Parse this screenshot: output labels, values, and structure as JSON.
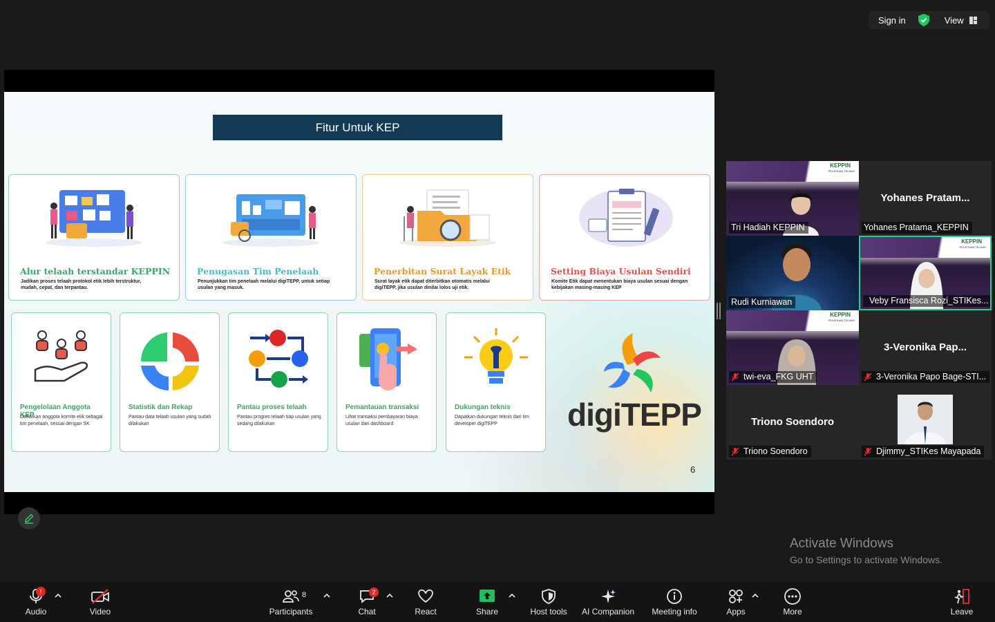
{
  "topbar": {
    "sign_in": "Sign in",
    "view": "View"
  },
  "slide": {
    "title": "Fitur Untuk KEP",
    "page_number": "6",
    "logo_text": "digiTEPP",
    "top_cards": [
      {
        "title": "Alur telaah terstandar KEPPIN",
        "desc": "Jadikan proses telaah protokol etik lebih terstruktur, mudah, cepat, dan terpantau.",
        "color": "#3fa36b",
        "border": "#8ed1a8"
      },
      {
        "title": "Penugasan Tim Penelaah",
        "desc": "Penunjukkan tim penelaah melalui digiTEPP, untuk setiap usulan yang masuk.",
        "color": "#4fb8c8",
        "border": "#8fd0e0"
      },
      {
        "title": "Penerbitan Surat Layak Etik",
        "desc": "Surat layak etik dapat diterbitkan otomatis melalui digiTEPP, jika usulan dinilai lolos uji etik.",
        "color": "#e39a2a",
        "border": "#f2c98a"
      },
      {
        "title": "Setting Biaya Usulan Sendiri",
        "desc": "Komite Etik dapat menentukan biaya usulan sesuai dengan kebijakan masing-masing KEP",
        "color": "#d9534f",
        "border": "#e8a0a0"
      }
    ],
    "bottom_cards": [
      {
        "title": "Pengelolaan Anggota KEP",
        "desc": "Daftarkan anggota komite etik sebagai tim penelaah, sesuai dengan SK"
      },
      {
        "title": "Statistik dan Rekap",
        "desc": "Pantau data telaah usulan yang sudah dilakukan"
      },
      {
        "title": "Pantau proses telaah",
        "desc": "Pantau progres telaah tiap usulan yang sedang dilakukan"
      },
      {
        "title": "Pemantauan transaksi",
        "desc": "Lihat transaksi pembayaran biaya usulan dari dashboard"
      },
      {
        "title": "Dukungan teknis",
        "desc": "Dapatkan dukungan teknis dari tim developer digiTEPP"
      }
    ]
  },
  "participants": [
    {
      "name": "Tri Hadiah KEPPIN",
      "big": "",
      "muted": false,
      "video": true
    },
    {
      "name": "Yohanes Pratama_KEPPIN",
      "big": "Yohanes  Pratam...",
      "muted": false,
      "video": false
    },
    {
      "name": "Rudi Kurniawan",
      "big": "",
      "muted": false,
      "video": true
    },
    {
      "name": "Veby Fransisca Rozi_STIKes...",
      "big": "",
      "muted": true,
      "video": true
    },
    {
      "name": "twi-eva_FKG UHT",
      "big": "",
      "muted": true,
      "video": true
    },
    {
      "name": "3-Veronika Papo Bage-STI...",
      "big": "3-Veronika  Pap...",
      "muted": true,
      "video": false
    },
    {
      "name": "Triono Soendoro",
      "big": "Triono Soendoro",
      "muted": true,
      "video": false
    },
    {
      "name": "Djimmy_STIKes Mayapada",
      "big": "",
      "muted": true,
      "video": true
    }
  ],
  "banner": {
    "logo": "KEPPIN",
    "sub": "PELATIHAN TELAAH"
  },
  "watermark": {
    "title": "Activate Windows",
    "sub": "Go to Settings to activate Windows."
  },
  "toolbar": {
    "audio": "Audio",
    "audio_badge": "!",
    "video": "Video",
    "participants": "Participants",
    "participant_count": "8",
    "chat": "Chat",
    "chat_badge": "2",
    "react": "React",
    "share": "Share",
    "host_tools": "Host tools",
    "ai_companion": "AI Companion",
    "meeting_info": "Meeting info",
    "apps": "Apps",
    "more": "More",
    "leave": "Leave"
  },
  "colors": {
    "accent_green": "#24d18a",
    "share_green": "#1fbf5f",
    "leave_red": "#e03131",
    "slide_title_bg": "#123a56"
  }
}
